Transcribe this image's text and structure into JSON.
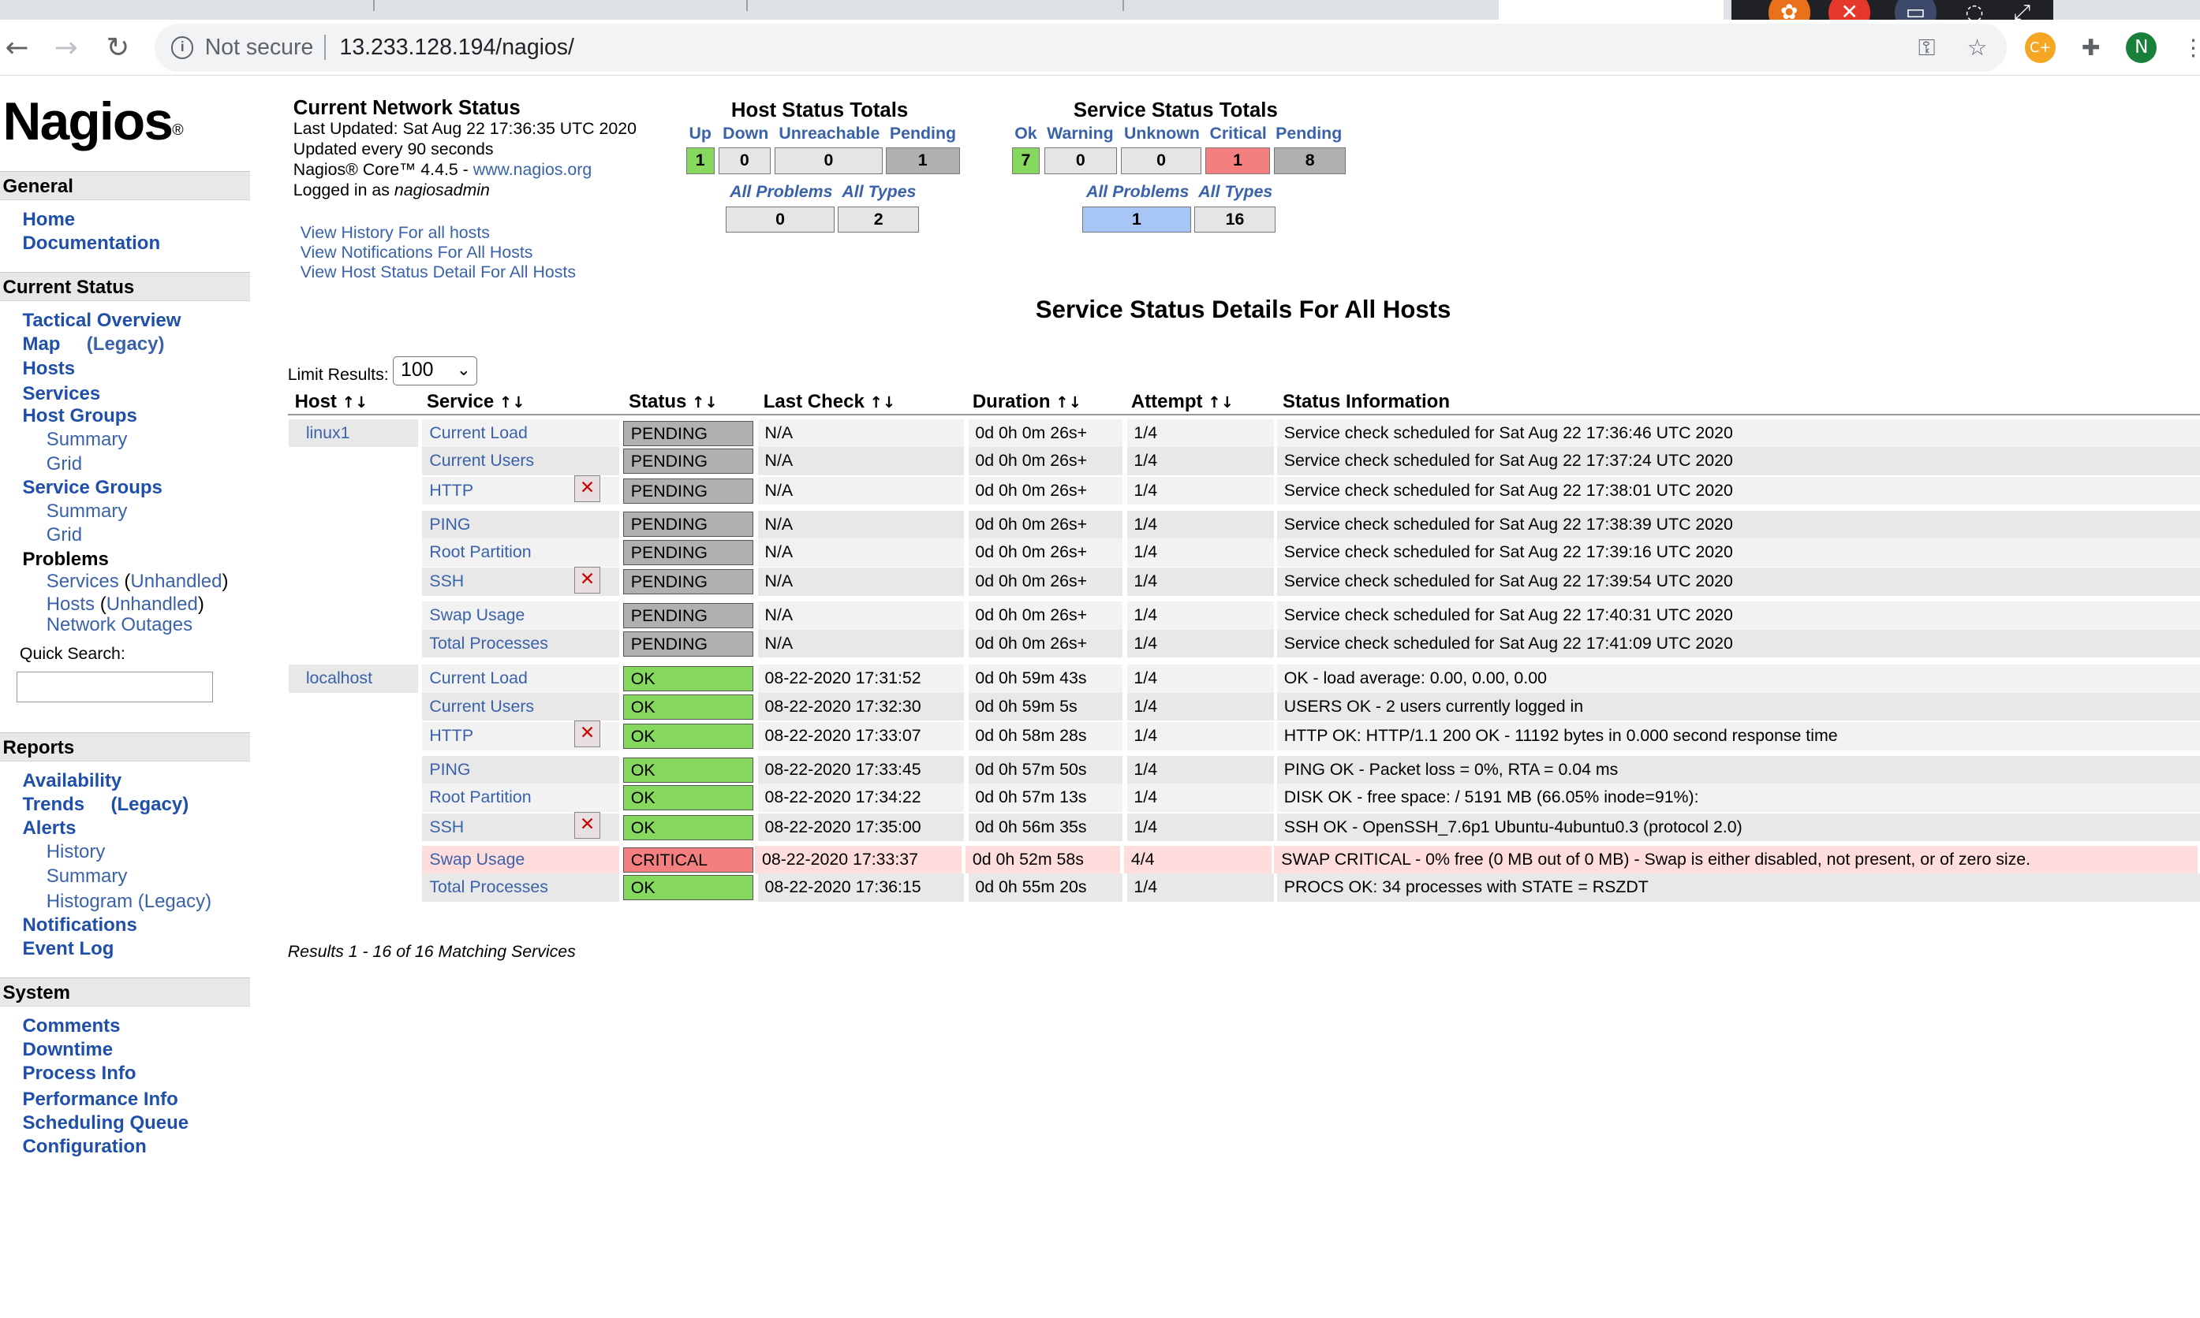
{
  "browser": {
    "security_label": "Not secure",
    "url": "13.233.128.194/nagios/",
    "avatar_letter": "N",
    "ext_badge": "C+"
  },
  "sidebar": {
    "logo_text": "Nagios",
    "logo_mark": "®",
    "sections": {
      "general": "General",
      "current_status": "Current Status",
      "reports": "Reports",
      "system": "System"
    },
    "general": {
      "home": "Home",
      "documentation": "Documentation"
    },
    "current": {
      "tactical": "Tactical Overview",
      "map": "Map",
      "map_legacy": "(Legacy)",
      "hosts": "Hosts",
      "services": "Services",
      "host_groups": "Host Groups",
      "hg_summary": "Summary",
      "hg_grid": "Grid",
      "service_groups": "Service Groups",
      "sg_summary": "Summary",
      "sg_grid": "Grid",
      "problems": "Problems",
      "p_services": "Services",
      "p_services_unh": "Unhandled",
      "p_hosts": "Hosts",
      "p_hosts_unh": "Unhandled",
      "p_outages": "Network Outages",
      "quick_search": "Quick Search:"
    },
    "reports": {
      "availability": "Availability",
      "trends": "Trends",
      "trends_legacy": "(Legacy)",
      "alerts": "Alerts",
      "history": "History",
      "summary": "Summary",
      "histogram": "Histogram (Legacy)",
      "notifications": "Notifications",
      "event_log": "Event Log"
    },
    "system": {
      "comments": "Comments",
      "downtime": "Downtime",
      "process_info": "Process Info",
      "performance_info": "Performance Info",
      "scheduling_queue": "Scheduling Queue",
      "configuration": "Configuration"
    }
  },
  "status": {
    "title": "Current Network Status",
    "last_updated": "Last Updated: Sat Aug 22 17:36:35 UTC 2020",
    "update_interval": "Updated every 90 seconds",
    "version_prefix": "Nagios® Core™ 4.4.5 - ",
    "version_link": "www.nagios.org",
    "logged_prefix": "Logged in as ",
    "user": "nagiosadmin",
    "links": [
      "View History For all hosts",
      "View Notifications For All Hosts",
      "View Host Status Detail For All Hosts"
    ]
  },
  "host_totals": {
    "title": "Host Status Totals",
    "labels": [
      "Up",
      "Down",
      "Unreachable",
      "Pending"
    ],
    "values": [
      "1",
      "0",
      "0",
      "1"
    ],
    "all_problems_label": "All Problems",
    "all_types_label": "All Types",
    "all_problems": "0",
    "all_types": "2"
  },
  "service_totals": {
    "title": "Service Status Totals",
    "labels": [
      "Ok",
      "Warning",
      "Unknown",
      "Critical",
      "Pending"
    ],
    "values": [
      "7",
      "0",
      "0",
      "1",
      "8"
    ],
    "all_problems_label": "All Problems",
    "all_types_label": "All Types",
    "all_problems": "1",
    "all_types": "16"
  },
  "details": {
    "title": "Service Status Details For All Hosts",
    "limit_label": "Limit Results:",
    "limit_value": "100",
    "columns": [
      "Host",
      "Service",
      "Status",
      "Last Check",
      "Duration",
      "Attempt",
      "Status Information"
    ],
    "results": "Results 1 - 16 of 16 Matching Services"
  },
  "rows": [
    {
      "host": "linux1",
      "service": "Current Load",
      "status": "PENDING",
      "last": "N/A",
      "duration": "0d 0h 0m 26s+",
      "attempt": "1/4",
      "info": "Service check scheduled for Sat Aug 22 17:36:46 UTC 2020"
    },
    {
      "host": "",
      "service": "Current Users",
      "status": "PENDING",
      "last": "N/A",
      "duration": "0d 0h 0m 26s+",
      "attempt": "1/4",
      "info": "Service check scheduled for Sat Aug 22 17:37:24 UTC 2020"
    },
    {
      "host": "",
      "service": "HTTP",
      "status": "PENDING",
      "last": "N/A",
      "duration": "0d 0h 0m 26s+",
      "attempt": "1/4",
      "info": "Service check scheduled for Sat Aug 22 17:38:01 UTC 2020",
      "icon": true
    },
    {
      "host": "",
      "service": "PING",
      "status": "PENDING",
      "last": "N/A",
      "duration": "0d 0h 0m 26s+",
      "attempt": "1/4",
      "info": "Service check scheduled for Sat Aug 22 17:38:39 UTC 2020"
    },
    {
      "host": "",
      "service": "Root Partition",
      "status": "PENDING",
      "last": "N/A",
      "duration": "0d 0h 0m 26s+",
      "attempt": "1/4",
      "info": "Service check scheduled for Sat Aug 22 17:39:16 UTC 2020"
    },
    {
      "host": "",
      "service": "SSH",
      "status": "PENDING",
      "last": "N/A",
      "duration": "0d 0h 0m 26s+",
      "attempt": "1/4",
      "info": "Service check scheduled for Sat Aug 22 17:39:54 UTC 2020",
      "icon": true
    },
    {
      "host": "",
      "service": "Swap Usage",
      "status": "PENDING",
      "last": "N/A",
      "duration": "0d 0h 0m 26s+",
      "attempt": "1/4",
      "info": "Service check scheduled for Sat Aug 22 17:40:31 UTC 2020"
    },
    {
      "host": "",
      "service": "Total Processes",
      "status": "PENDING",
      "last": "N/A",
      "duration": "0d 0h 0m 26s+",
      "attempt": "1/4",
      "info": "Service check scheduled for Sat Aug 22 17:41:09 UTC 2020"
    },
    {
      "host": "localhost",
      "service": "Current Load",
      "status": "OK",
      "last": "08-22-2020 17:31:52",
      "duration": "0d 0h 59m 43s",
      "attempt": "1/4",
      "info": "OK - load average: 0.00, 0.00, 0.00"
    },
    {
      "host": "",
      "service": "Current Users",
      "status": "OK",
      "last": "08-22-2020 17:32:30",
      "duration": "0d 0h 59m 5s",
      "attempt": "1/4",
      "info": "USERS OK - 2 users currently logged in"
    },
    {
      "host": "",
      "service": "HTTP",
      "status": "OK",
      "last": "08-22-2020 17:33:07",
      "duration": "0d 0h 58m 28s",
      "attempt": "1/4",
      "info": "HTTP OK: HTTP/1.1 200 OK - 11192 bytes in 0.000 second response time",
      "icon": true
    },
    {
      "host": "",
      "service": "PING",
      "status": "OK",
      "last": "08-22-2020 17:33:45",
      "duration": "0d 0h 57m 50s",
      "attempt": "1/4",
      "info": "PING OK - Packet loss = 0%, RTA = 0.04 ms"
    },
    {
      "host": "",
      "service": "Root Partition",
      "status": "OK",
      "last": "08-22-2020 17:34:22",
      "duration": "0d 0h 57m 13s",
      "attempt": "1/4",
      "info": "DISK OK - free space: / 5191 MB (66.05% inode=91%):"
    },
    {
      "host": "",
      "service": "SSH",
      "status": "OK",
      "last": "08-22-2020 17:35:00",
      "duration": "0d 0h 56m 35s",
      "attempt": "1/4",
      "info": "SSH OK - OpenSSH_7.6p1 Ubuntu-4ubuntu0.3 (protocol 2.0)",
      "icon": true
    },
    {
      "host": "",
      "service": "Swap Usage",
      "status": "CRITICAL",
      "last": "08-22-2020 17:33:37",
      "duration": "0d 0h 52m 58s",
      "attempt": "4/4",
      "info": "SWAP CRITICAL - 0% free (0 MB out of 0 MB) - Swap is either disabled, not present, or of zero size."
    },
    {
      "host": "",
      "service": "Total Processes",
      "status": "OK",
      "last": "08-22-2020 17:36:15",
      "duration": "0d 0h 55m 20s",
      "attempt": "1/4",
      "info": "PROCS OK: 34 processes with STATE = RSZDT"
    }
  ],
  "colors": {
    "pending": "#b0b0b0",
    "ok": "#87d85f",
    "critical": "#f37f7f",
    "link": "#3a62ab"
  }
}
